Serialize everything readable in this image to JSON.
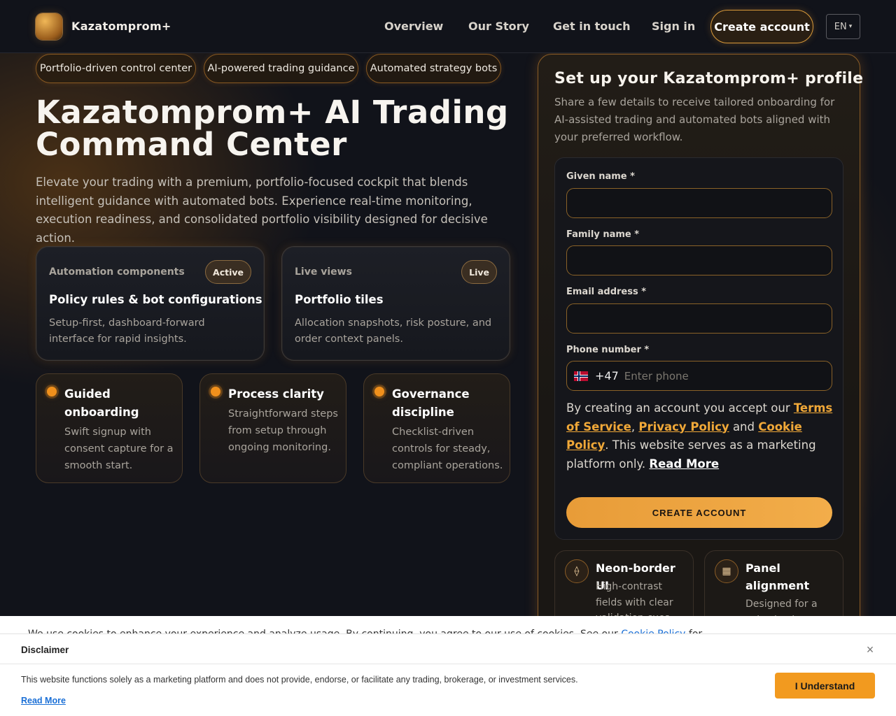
{
  "header": {
    "brand": "Kazatomprom+",
    "nav": [
      "Overview",
      "Our Story",
      "Get in touch",
      "Sign in"
    ],
    "create_account": "Create account",
    "language": "EN",
    "caret": "▾"
  },
  "hero": {
    "pills": [
      "Portfolio-driven control center",
      "AI-powered trading guidance",
      "Automated strategy bots"
    ],
    "title_line1": "Kazatomprom+ AI Trading",
    "title_line2": "Command Center",
    "subtitle": "Elevate your trading with a premium, portfolio-focused cockpit that blends intelligent guidance with automated bots. Experience real-time monitoring, execution readiness, and consolidated portfolio visibility designed for decisive action."
  },
  "cards": [
    {
      "kicker": "Automation components",
      "badge": "Active",
      "title": "Policy rules & bot configurations",
      "desc": "Setup-first, dashboard-forward interface for rapid insights."
    },
    {
      "kicker": "Live views",
      "badge": "Live",
      "title": "Portfolio tiles",
      "desc": "Allocation snapshots, risk posture, and order context panels."
    }
  ],
  "features": [
    {
      "title": "Guided onboarding",
      "desc": "Swift signup with consent capture for a smooth start."
    },
    {
      "title": "Process clarity",
      "desc": "Straightforward steps from setup through ongoing monitoring."
    },
    {
      "title": "Governance discipline",
      "desc": "Checklist-driven controls for steady, compliant operations."
    }
  ],
  "form": {
    "title": "Set up your Kazatomprom+ profile",
    "subtitle": "Share a few details to receive tailored onboarding for AI-assisted trading and automated bots aligned with your preferred workflow.",
    "given_name_label": "Given name *",
    "family_name_label": "Family name *",
    "email_label": "Email address *",
    "phone_label": "Phone number *",
    "phone_code": "+47",
    "phone_placeholder": "Enter phone",
    "consent_pre": "By creating an account you accept our ",
    "terms": "Terms of Service",
    "comma": ", ",
    "privacy": "Privacy Policy",
    "and": " and ",
    "cookie": "Cookie Policy",
    "consent_post": ". This website serves as a marketing platform only. ",
    "read_more": "Read More",
    "submit": "CREATE ACCOUNT"
  },
  "mini_features": [
    {
      "icon": "⟠",
      "title": "Neon-border UI",
      "desc": "High-contrast fields with clear validation cues."
    },
    {
      "icon": "▦",
      "title": "Panel alignment",
      "desc": "Designed for a cohesive layout."
    }
  ],
  "cookie_strip": {
    "text": "We use cookies to enhance your experience and analyze usage. By continuing, you agree to our use of cookies. See our",
    "link": "Cookie Policy",
    "tail": "for"
  },
  "disclaimer": {
    "title": "Disclaimer",
    "close": "×",
    "text": "This website functions solely as a marketing platform and does not provide, endorse, or facilitate any trading, brokerage, or investment services.",
    "read_more": "Read More",
    "button": "I Understand"
  }
}
